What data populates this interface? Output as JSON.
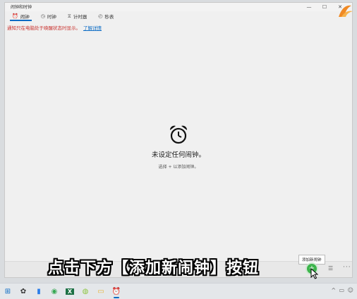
{
  "window": {
    "title": "闹钟和时钟",
    "controls": [
      "—",
      "☐",
      "✕"
    ]
  },
  "tabs": [
    {
      "icon": "⏰",
      "label": "闹钟",
      "active": true
    },
    {
      "icon": "◷",
      "label": "时钟",
      "active": false
    },
    {
      "icon": "⧖",
      "label": "计时器",
      "active": false
    },
    {
      "icon": "◴",
      "label": "秒表",
      "active": false
    }
  ],
  "notice": {
    "text": "通知只在电脑处于唤醒状态时显示。",
    "link": "了解详情"
  },
  "empty_state": {
    "title": "未设定任何闹钟。",
    "subtitle": "选择 + 以添加闹钟。"
  },
  "bottombar": {
    "tooltip": "添加新闹钟",
    "add_symbol": "+",
    "select_symbol": "☰",
    "more_symbol": "···"
  },
  "caption": "点击下方【添加新闹钟】按钮",
  "taskbar": {
    "items": [
      {
        "icon": "⊞",
        "name": "start"
      },
      {
        "icon": "✿",
        "name": "app-flower"
      },
      {
        "icon": "▮",
        "name": "app-blue"
      },
      {
        "icon": "◉",
        "name": "app-green"
      },
      {
        "icon": "X",
        "name": "excel"
      },
      {
        "icon": "◍",
        "name": "app-lime"
      },
      {
        "icon": "▭",
        "name": "explorer"
      },
      {
        "icon": "⏰",
        "name": "alarms"
      }
    ],
    "tray": "^ ▭ ☺"
  },
  "colors": {
    "accent": "#0a6bc4",
    "notice_red": "#c9302c",
    "add_green": "#3cb44b"
  }
}
